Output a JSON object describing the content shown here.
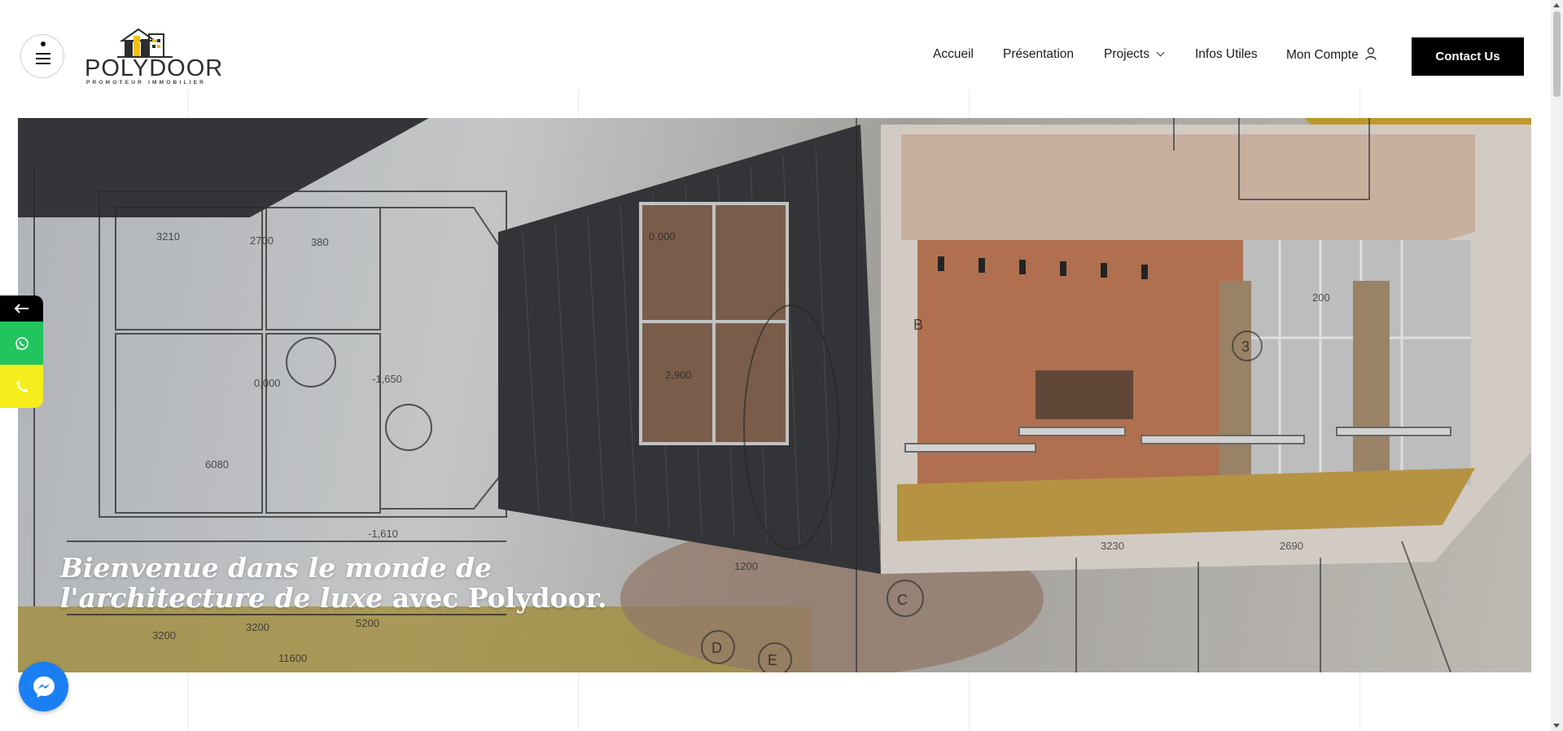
{
  "header": {
    "logo": {
      "name": "POLYDOOR",
      "tagline": "PROMOTEUR   IMMOBILIER"
    },
    "nav": [
      {
        "label": "Accueil"
      },
      {
        "label": "Présentation"
      },
      {
        "label": "Projects"
      },
      {
        "label": "Infos Utiles"
      },
      {
        "label": "Mon Compte"
      }
    ],
    "contact_label": "Contact Us"
  },
  "hero": {
    "title_italic": "Bienvenue dans le monde de l'architecture de luxe",
    "title_regular": " avec Polydoor."
  },
  "side_buttons": {
    "back_icon": "arrow-left-icon",
    "whatsapp_icon": "whatsapp-icon",
    "phone_icon": "phone-icon",
    "whatsapp_color": "#21c45d",
    "phone_color": "#f5ee1c"
  },
  "messenger": {
    "icon": "messenger-icon",
    "color": "#1a7ff3"
  },
  "colors": {
    "accent": "#f2c200",
    "button": "#000000"
  }
}
